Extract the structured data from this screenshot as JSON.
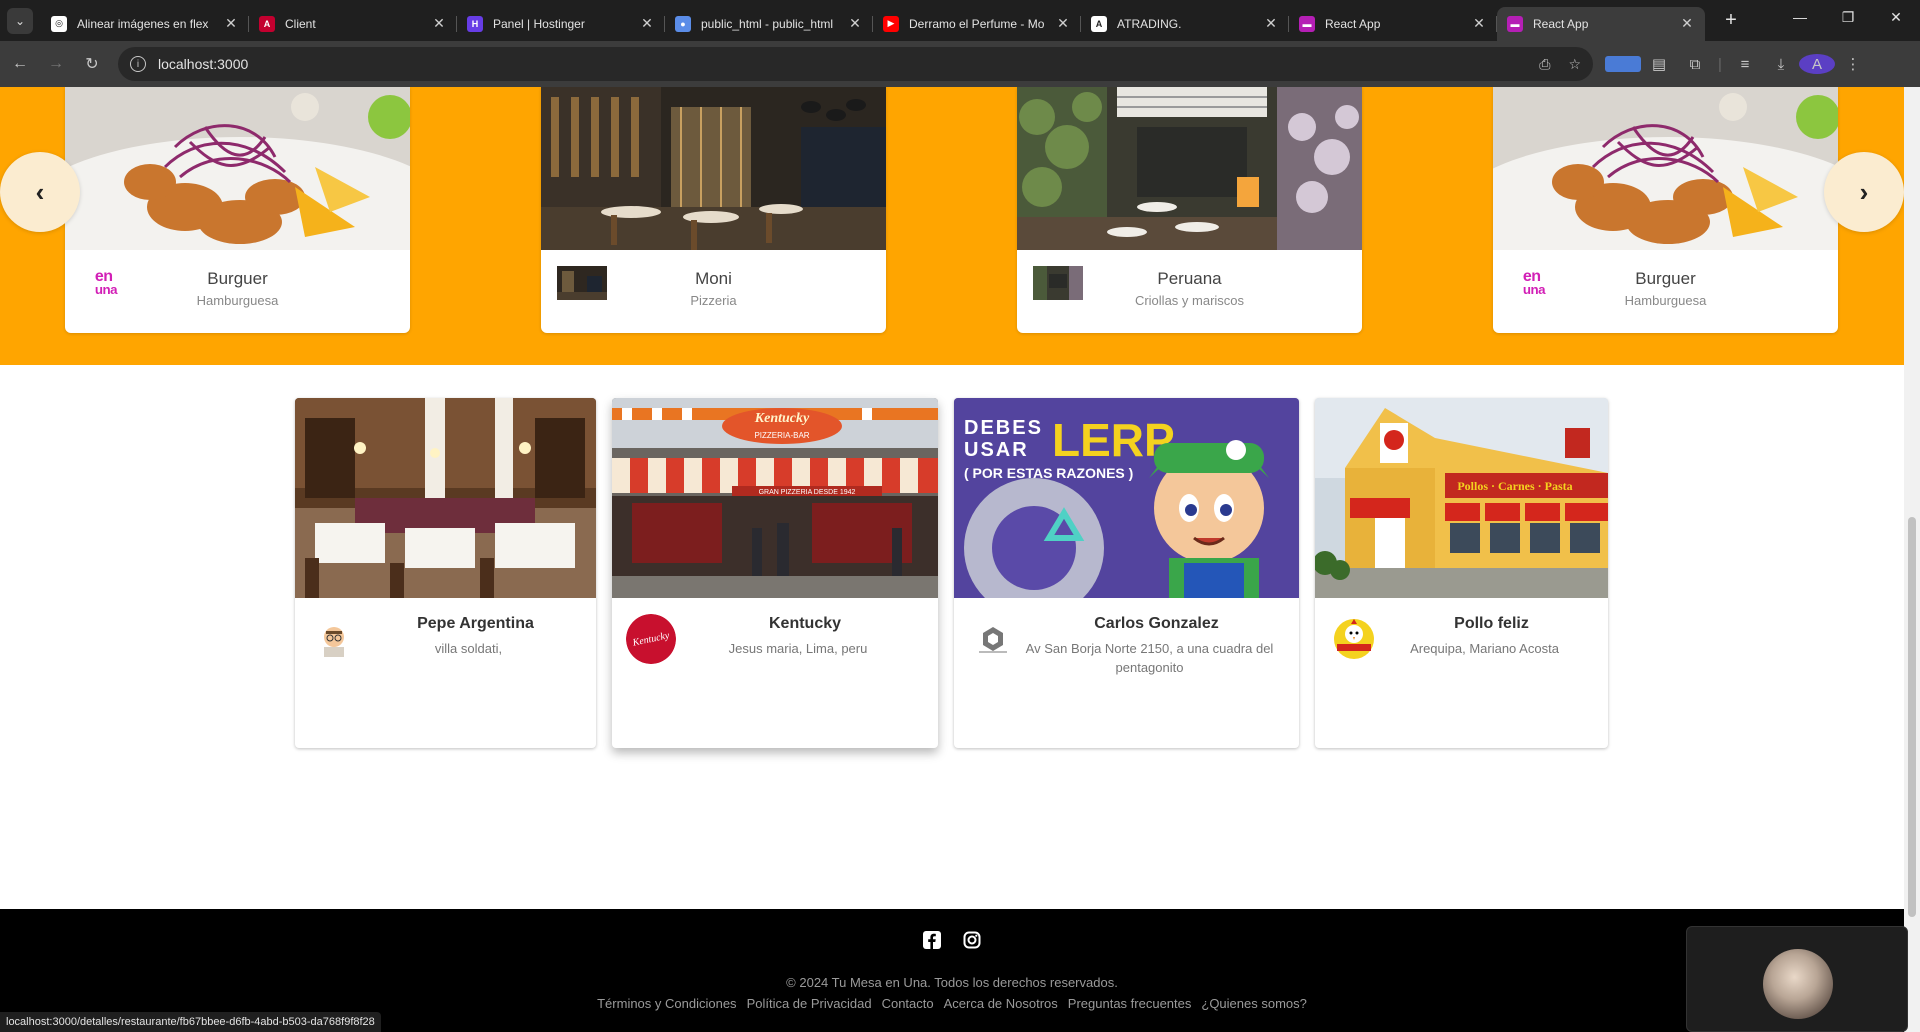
{
  "browser": {
    "tabs": [
      {
        "title": "Alinear imágenes en flex",
        "favicon_color": "#ffffff",
        "favicon_text": "◎"
      },
      {
        "title": "Client",
        "favicon_color": "#c3002f",
        "favicon_text": "A"
      },
      {
        "title": "Panel | Hostinger",
        "favicon_color": "#673de6",
        "favicon_text": "H"
      },
      {
        "title": "public_html - public_html",
        "favicon_color": "#5b8de8",
        "favicon_text": "●"
      },
      {
        "title": "Derramo el Perfume - Mo",
        "favicon_color": "#ff0000",
        "favicon_text": "▶"
      },
      {
        "title": "ATRADING.",
        "favicon_color": "#ffffff",
        "favicon_text": "A"
      },
      {
        "title": "React App",
        "favicon_color": "#b51fb5",
        "favicon_text": "▬"
      },
      {
        "title": "React App",
        "favicon_color": "#b51fb5",
        "favicon_text": "▬"
      }
    ],
    "active_tab_index": 7,
    "url": "localhost:3000",
    "profile_initial": "A",
    "status_url": "localhost:3000/detalles/restaurante/fb67bbee-d6fb-4abd-b503-da768f9f8f28"
  },
  "carousel": {
    "background": "#ffa500",
    "slides": [
      {
        "name": "Burguer",
        "category": "Hamburguesa",
        "logo": "enuna"
      },
      {
        "name": "Moni",
        "category": "Pizzeria",
        "logo": "photo"
      },
      {
        "name": "Peruana",
        "category": "Criollas y mariscos",
        "logo": "photo"
      },
      {
        "name": "Burguer",
        "category": "Hamburguesa",
        "logo": "enuna"
      }
    ],
    "logo_text": {
      "line1": "en",
      "line2": "una"
    },
    "prev_icon": "chevron-left-icon",
    "next_icon": "chevron-right-icon"
  },
  "restaurants": [
    {
      "name": "Pepe Argentina",
      "address": "villa soldati,"
    },
    {
      "name": "Kentucky",
      "address": "Jesus maria, Lima, peru",
      "logo_text": "Kentucky"
    },
    {
      "name": "Carlos Gonzalez",
      "address": "Av San Borja Norte 2150, a una cuadra del pentagonito"
    },
    {
      "name": "Pollo feliz",
      "address": "Arequipa, Mariano Acosta"
    }
  ],
  "banner_text": {
    "line1": "DEBES",
    "line2": "USAR",
    "big": "LERP",
    "sub": "( POR ESTAS RAZONES )"
  },
  "kentucky_sign": "Kentucky",
  "kentucky_subsign": "PIZZERIA-BAR",
  "kentucky_awning": "GRAN PIZZERIA DESDE 1942",
  "footer": {
    "copyright": "© 2024 Tu Mesa en Una. Todos los derechos reservados.",
    "links": [
      "Términos y Condiciones",
      "Política de Privacidad",
      "Contacto",
      "Acerca de Nosotros",
      "Preguntas frecuentes",
      "¿Quienes somos?"
    ],
    "social": [
      "facebook-icon",
      "instagram-icon"
    ]
  }
}
